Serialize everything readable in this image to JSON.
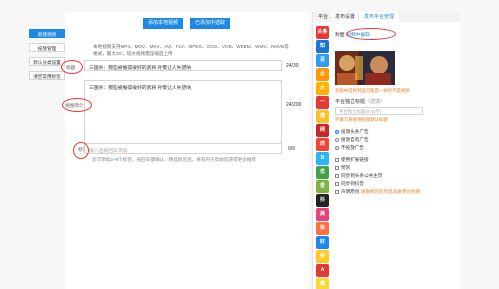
{
  "left_menu": {
    "items": [
      {
        "label": "新建视频",
        "active": true
      },
      {
        "label": "投放管理"
      },
      {
        "label": "默认分类设置"
      },
      {
        "label": "清空常用标签"
      }
    ]
  },
  "upload": {
    "add_local_label": "添加本地视频",
    "select_existing_label": "已添加中选取",
    "formats_text": "本地视频支持MP4、MOV、MKV、AVI、FLV、MPEG、OGG、VOB、WEBM、WMV、RMVB等格式，最大2G，较大视频需压缩后上传"
  },
  "title_field": {
    "label": "标题",
    "value": "三国杀：那些被推得很好的武将 孙策让人失望呐",
    "counter": "24/30"
  },
  "summary_field": {
    "label": "视频简介",
    "value": "三国杀：那些被推得很好的武将 孙策让人失望呐",
    "counter": "24/200"
  },
  "tags_field": {
    "label": "标签",
    "placeholder": "输入后按回车添加",
    "counter": "0/9",
    "hint_prefix": "您可添加",
    "hint_count": "2~9个",
    "hint_suffix": "标签，按回车键确认。精选标签后，将有利于帮助您获得更多推荐"
  },
  "platform_column": {
    "header": "平台",
    "icons": [
      {
        "icon": "toutiao-icon",
        "text": "头条",
        "color": "#e53935"
      },
      {
        "icon": "zhihu-icon",
        "text": "知",
        "color": "#1976d2"
      },
      {
        "icon": "baijia-icon",
        "text": "百",
        "color": "#2e9df0"
      },
      {
        "icon": "qiehao-icon",
        "text": "企",
        "color": "#ff9800"
      },
      {
        "icon": "dayu-icon",
        "text": "大",
        "color": "#ffb300"
      },
      {
        "icon": "yidian-icon",
        "text": "一",
        "color": "#e53935"
      },
      {
        "icon": "sohu-icon",
        "text": "搜",
        "color": "#fbc02d"
      },
      {
        "icon": "wangyi-icon",
        "text": "网",
        "color": "#c62828"
      },
      {
        "icon": "xigua-icon",
        "text": "西",
        "color": "#f44336"
      },
      {
        "icon": "bilibili-icon",
        "text": "B",
        "color": "#29b6f6"
      },
      {
        "icon": "youku-icon",
        "text": "优",
        "color": "#43a047"
      },
      {
        "icon": "aiqiyi-icon",
        "text": "爱",
        "color": "#7cb342"
      },
      {
        "icon": "douyin-icon",
        "text": "抖",
        "color": "#222222"
      },
      {
        "icon": "meipai-icon",
        "text": "美",
        "color": "#ec407a"
      },
      {
        "icon": "kuaishou-icon",
        "text": "快",
        "color": "#ff7043"
      },
      {
        "icon": "haokan-icon",
        "text": "好",
        "color": "#1e88e5"
      },
      {
        "icon": "miaopai-icon",
        "text": "秒",
        "color": "#ffca28"
      },
      {
        "icon": "acfun-icon",
        "text": "A",
        "color": "#e53935"
      },
      {
        "icon": "weishi-icon",
        "text": "微",
        "color": "#fdd835"
      }
    ]
  },
  "settings": {
    "tab_publish": "发布设置",
    "tab_platform_mgmt": "发布平台管理",
    "cover_label": "封面",
    "cover_link": "视频中截取",
    "cover_warning": "封面中选择封面可能是一帧的不是视频",
    "platform_title_label": "平台独立标题",
    "platform_title_optional": "（选填）",
    "platform_title_placeholder": "平台独立标题(5-30字)",
    "platform_title_warning": "不填写将使用视频默认标题",
    "ad_options": [
      {
        "label": "投放头条广告",
        "checked": true
      },
      {
        "label": "投放自有广告"
      },
      {
        "label": "不投放广告"
      }
    ],
    "extra_options": [
      {
        "label": "使用扩展链接"
      },
      {
        "label": "赞赏"
      },
      {
        "label": "同步到头条公共主页"
      },
      {
        "label": "同步到抖音"
      }
    ],
    "declaration_label": "声明原创",
    "declaration_link": "请确保您的作品具备原创权限"
  },
  "colors": {
    "accent": "#1e88e5",
    "annotation_red": "#e53935",
    "warning_orange": "#e67e22"
  }
}
